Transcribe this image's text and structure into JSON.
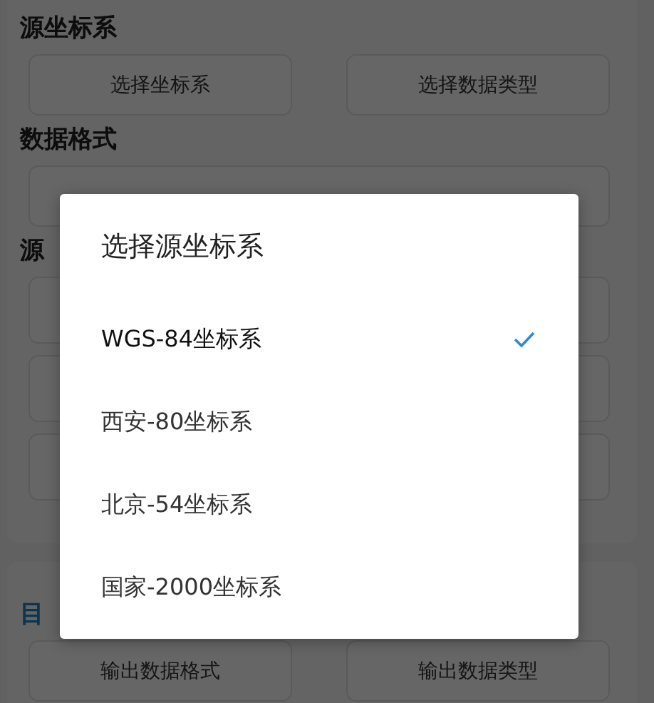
{
  "cards": [
    {
      "sections": [
        {
          "title": "源坐标系",
          "accent": false,
          "buttons": [
            "选择坐标系",
            "选择数据类型"
          ]
        },
        {
          "title": "数据格式",
          "accent": false,
          "kind": "wide_button"
        },
        {
          "title": "源",
          "accent": false,
          "kind": "field_group"
        }
      ]
    },
    {
      "sections": [
        {
          "title": "目",
          "accent": true,
          "buttons": [
            "输出数据格式",
            "输出数据类型"
          ]
        }
      ]
    }
  ],
  "dialog": {
    "title": "选择源坐标系",
    "options": [
      {
        "label": "WGS-84坐标系",
        "selected": true
      },
      {
        "label": "西安-80坐标系",
        "selected": false
      },
      {
        "label": "北京-54坐标系",
        "selected": false
      },
      {
        "label": "国家-2000坐标系",
        "selected": false
      }
    ]
  }
}
